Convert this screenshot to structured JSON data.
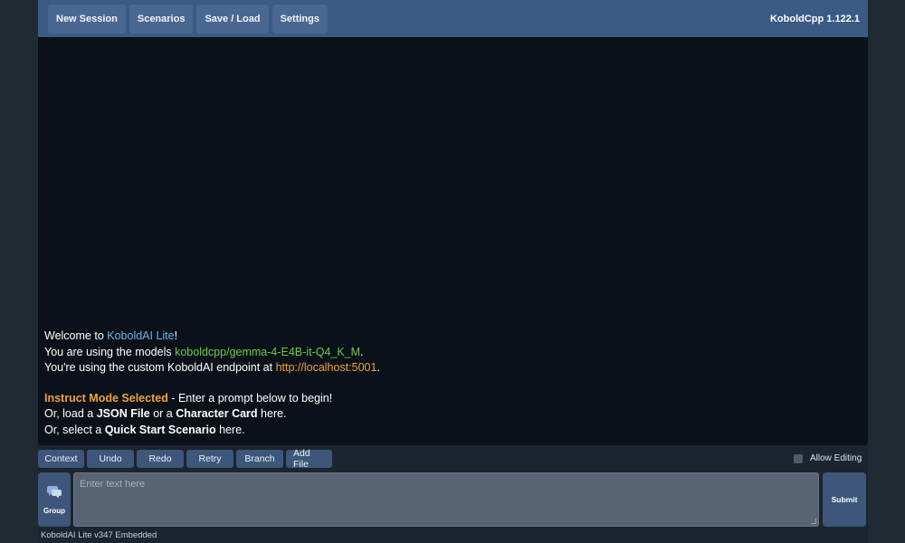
{
  "nav": {
    "buttons": [
      "New Session",
      "Scenarios",
      "Save / Load",
      "Settings"
    ],
    "version": "KoboldCpp 1.122.1"
  },
  "welcome": {
    "l1_pre": "Welcome to ",
    "l1_link": "KoboldAI Lite",
    "l1_post": "!",
    "l2_pre": "You are using the models ",
    "l2_model": "koboldcpp/gemma-4-E4B-it-Q4_K_M",
    "l2_post": ".",
    "l3_pre": "You're using the custom KoboldAI endpoint at ",
    "l3_url": "http://localhost:5001",
    "l3_post": ".",
    "l4_mode": "Instruct Mode Selected",
    "l4_post": " - Enter a prompt below to begin!",
    "l5_pre": "Or, load a ",
    "l5_json": "JSON File",
    "l5_mid": " or a ",
    "l5_card": "Character Card",
    "l5_post": " here.",
    "l6_pre": "Or, select a ",
    "l6_qs": "Quick Start Scenario",
    "l6_post": " here."
  },
  "actions": [
    "Context",
    "Undo",
    "Redo",
    "Retry",
    "Branch",
    "Add File"
  ],
  "allow_editing": {
    "label": "Allow Editing",
    "checked": false
  },
  "input": {
    "group_label": "Group",
    "placeholder": "Enter text here",
    "submit_label": "Submit"
  },
  "footer": "KoboldAI Lite v347 Embedded",
  "colors": {
    "topbar": "#3b5a84",
    "story_bg": "#0b1119",
    "link_blue": "#6cb6e8",
    "model_green": "#6fc94b",
    "accent_orange": "#f0a33a"
  }
}
